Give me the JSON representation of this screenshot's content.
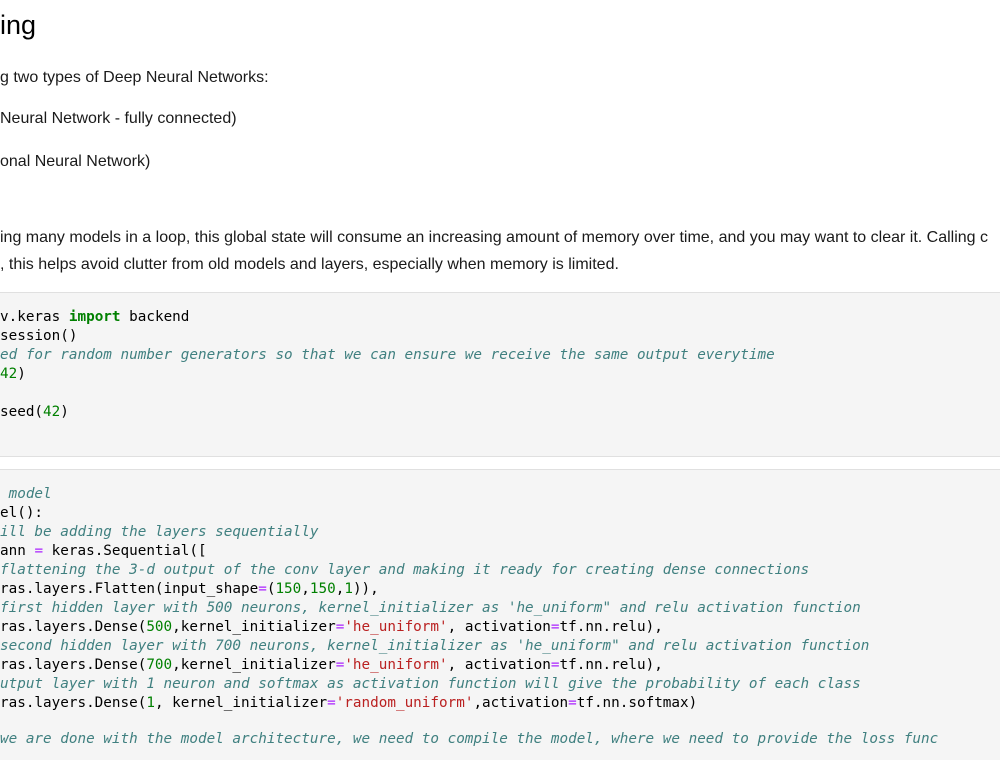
{
  "markdown": {
    "title": "ing",
    "line1": "g two types of Deep Neural Networks:",
    "line2": "Neural Network - fully connected)",
    "line3": "onal Neural Network)",
    "line4": "ing many models in a loop, this global state will consume an increasing amount of memory over time, and you may want to clear it. Calling c",
    "line5": ", this helps avoid clutter from old models and layers, especially when memory is limited."
  },
  "cell1": {
    "l1_a": "v.keras ",
    "l1_kw": "import",
    "l1_b": " backend",
    "l2": "session()",
    "l3_comment": "ed for random number generators so that we can ensure we receive the same output everytime",
    "l4_num": "42",
    "l4_close": ")",
    "l5_a": "seed(",
    "l5_num": "42",
    "l5_close": ")"
  },
  "cell2": {
    "c1": " model",
    "l2": "el():",
    "c3": "ill be adding the layers sequentially",
    "l4_a": "ann ",
    "l4_op": "=",
    "l4_b": " keras.Sequential([",
    "c5": "flattening the 3-d output of the conv layer and making it ready for creating dense connections",
    "l6_a": "ras.layers.Flatten(input_shape",
    "l6_op": "=",
    "l6_b": "(",
    "l6_n1": "150",
    "l6_c1": ",",
    "l6_n2": "150",
    "l6_c2": ",",
    "l6_n3": "1",
    "l6_end": ")),",
    "c7": "first hidden layer with 500 neurons, kernel_initializer as 'he_uniform\" and relu activation function",
    "l8_a": "ras.layers.Dense(",
    "l8_n": "500",
    "l8_b": ",kernel_initializer",
    "l8_op": "=",
    "l8_s": "'he_uniform'",
    "l8_c": ", activation",
    "l8_op2": "=",
    "l8_d": "tf.nn.relu),",
    "c9": "second hidden layer with 700 neurons, kernel_initializer as 'he_uniform\" and relu activation function",
    "l10_a": "ras.layers.Dense(",
    "l10_n": "700",
    "l10_b": ",kernel_initializer",
    "l10_op": "=",
    "l10_s": "'he_uniform'",
    "l10_c": ", activation",
    "l10_op2": "=",
    "l10_d": "tf.nn.relu),",
    "c11": "utput layer with 1 neuron and softmax as activation function will give the probability of each class",
    "l12_a": "ras.layers.Dense(",
    "l12_n": "1",
    "l12_b": ", kernel_initializer",
    "l12_op": "=",
    "l12_s": "'random_uniform'",
    "l12_c": ",activation",
    "l12_op2": "=",
    "l12_d": "tf.nn.softmax)"
  },
  "tail": " we are done with the model architecture, we need to compile the model, where we need to provide the loss func"
}
